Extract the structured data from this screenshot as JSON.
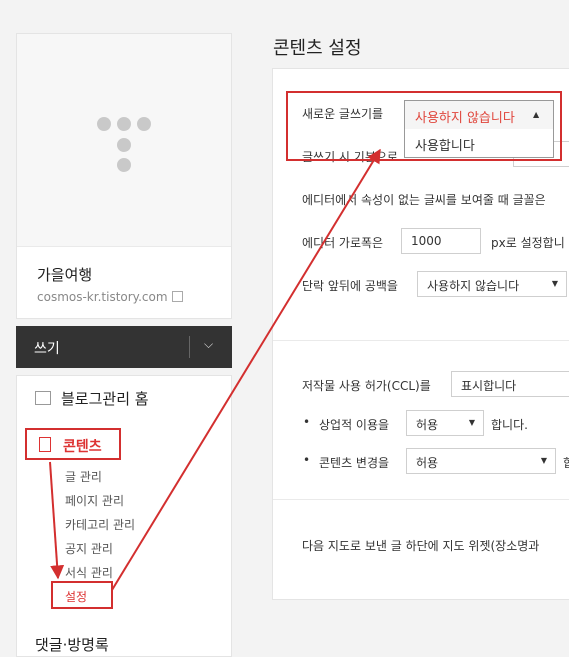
{
  "sidebar": {
    "blog_name": "가을여행",
    "blog_url": "cosmos-kr.tistory.com",
    "write_label": "쓰기",
    "home_label": "블로그관리 홈",
    "content_label": "콘텐츠",
    "sub_items": [
      "글 관리",
      "페이지 관리",
      "카테고리 관리",
      "공지 관리",
      "서식 관리",
      "설정"
    ],
    "next_label": "댓글·방명록"
  },
  "main": {
    "title": "콘텐츠 설정",
    "rows": {
      "new_editor": "새로운 글쓰기를",
      "default_write": "글쓰기 시 기본으로",
      "font_notice": "에디터에서 속성이 없는 글씨를 보여줄 때 글꼴은",
      "editor_width_prefix": "에디터 가로폭은",
      "editor_width_value": "1000",
      "editor_width_suffix": "px로 설정합니",
      "paragraph": "단락 앞뒤에 공백을",
      "paragraph_value": "사용하지 않습니다",
      "ccl": "저작물 사용 허가(CCL)를",
      "ccl_value": "표시합니다",
      "commercial": "상업적 이용을",
      "commercial_value": "허용",
      "commercial_suffix": "합니다.",
      "modify": "콘텐츠 변경을",
      "modify_value": "허용",
      "modify_suffix": "합",
      "map_widget": "다음 지도로 보낸 글 하단에 지도 위젯(장소명과"
    },
    "dropdown": {
      "selected": "사용하지 않습니다",
      "option2": "사용합니다"
    }
  },
  "colors": {
    "accent": "#d32f2f",
    "selected_option": "#e0463c"
  }
}
